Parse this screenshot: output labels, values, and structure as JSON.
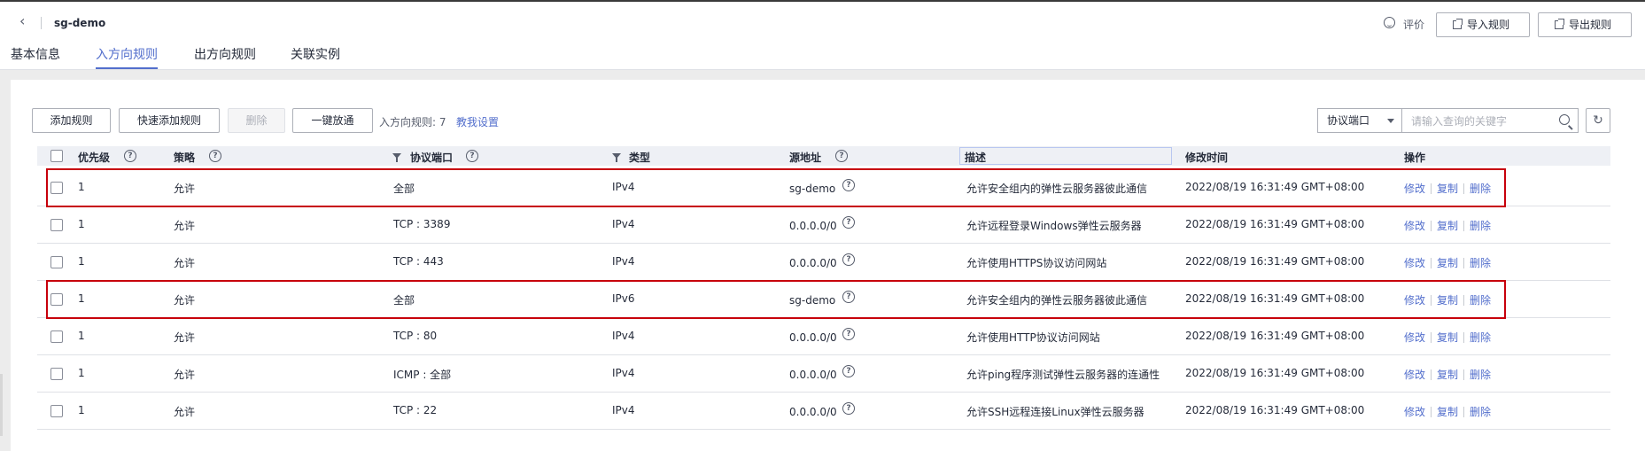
{
  "header": {
    "title": "sg-demo",
    "tabs": [
      "基本信息",
      "入方向规则",
      "出方向规则",
      "关联实例"
    ],
    "active_tab": "入方向规则",
    "eval_label": "评价",
    "import_label": "导入规则",
    "export_label": "导出规则"
  },
  "toolbar": {
    "add_rule": "添加规则",
    "quick_add": "快速添加规则",
    "delete": "删除",
    "allow_all": "一键放通",
    "rule_count": "入方向规则: 7",
    "tutorial": "教我设置",
    "filter_select": "协议端口",
    "search_placeholder": "请输入查询的关键字"
  },
  "table": {
    "columns": [
      "优先级",
      "策略",
      "协议端口",
      "类型",
      "源地址",
      "描述",
      "修改时间",
      "操作"
    ],
    "rows": [
      {
        "priority": "1",
        "policy": "允许",
        "port": "全部",
        "type": "IPv4",
        "source": "sg-demo",
        "source_link": true,
        "desc": "允许安全组内的弹性云服务器彼此通信",
        "time": "2022/08/19 16:31:49 GMT+08:00",
        "highlighted": true
      },
      {
        "priority": "1",
        "policy": "允许",
        "port": "TCP : 3389",
        "type": "IPv4",
        "source": "0.0.0.0/0",
        "source_link": false,
        "desc": "允许远程登录Windows弹性云服务器",
        "time": "2022/08/19 16:31:49 GMT+08:00",
        "highlighted": false
      },
      {
        "priority": "1",
        "policy": "允许",
        "port": "TCP : 443",
        "type": "IPv4",
        "source": "0.0.0.0/0",
        "source_link": false,
        "desc": "允许使用HTTPS协议访问网站",
        "time": "2022/08/19 16:31:49 GMT+08:00",
        "highlighted": false
      },
      {
        "priority": "1",
        "policy": "允许",
        "port": "全部",
        "type": "IPv6",
        "source": "sg-demo",
        "source_link": true,
        "desc": "允许安全组内的弹性云服务器彼此通信",
        "time": "2022/08/19 16:31:49 GMT+08:00",
        "highlighted": true
      },
      {
        "priority": "1",
        "policy": "允许",
        "port": "TCP : 80",
        "type": "IPv4",
        "source": "0.0.0.0/0",
        "source_link": false,
        "desc": "允许使用HTTP协议访问网站",
        "time": "2022/08/19 16:31:49 GMT+08:00",
        "highlighted": false
      },
      {
        "priority": "1",
        "policy": "允许",
        "port": "ICMP : 全部",
        "type": "IPv4",
        "source": "0.0.0.0/0",
        "source_link": false,
        "desc": "允许ping程序测试弹性云服务器的连通性",
        "time": "2022/08/19 16:31:49 GMT+08:00",
        "highlighted": false
      },
      {
        "priority": "1",
        "policy": "允许",
        "port": "TCP : 22",
        "type": "IPv4",
        "source": "0.0.0.0/0",
        "source_link": false,
        "desc": "允许SSH远程连接Linux弹性云服务器",
        "time": "2022/08/19 16:31:49 GMT+08:00",
        "highlighted": false
      }
    ],
    "ops": [
      "修改",
      "复制",
      "删除"
    ]
  },
  "colors": {
    "accent": "#526ecc",
    "highlight_border": "#c7000b"
  }
}
